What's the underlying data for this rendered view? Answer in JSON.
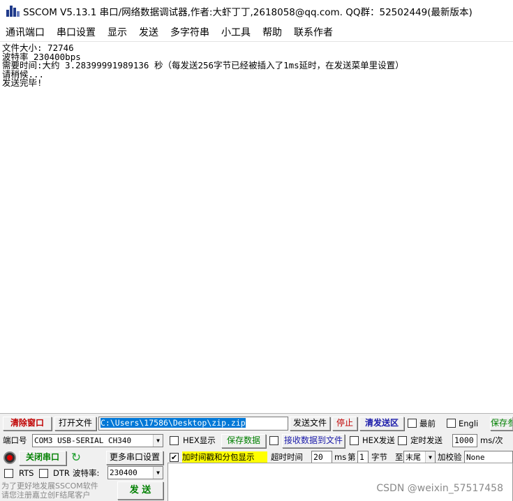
{
  "window": {
    "title": "SSCOM V5.13.1 串口/网络数据调试器,作者:大虾丁丁,2618058@qq.com. QQ群：52502449(最新版本)",
    "logo_icon": "sscom-bars-icon"
  },
  "menu": [
    "通讯端口",
    "串口设置",
    "显示",
    "发送",
    "多字符串",
    "小工具",
    "帮助",
    "联系作者"
  ],
  "output": {
    "lines": [
      "文件大小: 72746",
      "波特率 230400bps",
      "需要时间:大约 3.28399991989136 秒（每发送256字节已经被插入了1ms延时，在发送菜单里设置）",
      "请稍候...",
      "发送完毕!"
    ]
  },
  "toolbar1": {
    "clear_button": "清除窗口",
    "open_file_button": "打开文件",
    "file_path": "C:\\Users\\17586\\Desktop\\zip.zip",
    "send_file_button": "发送文件",
    "stop_button": "停止",
    "clear_send_button": "清发送区",
    "topmost_label": "最前",
    "english_label": "Engli",
    "save_params_label": "保存参"
  },
  "toolbar2": {
    "port_label": "端口号",
    "port_value": "COM3 USB-SERIAL CH340",
    "hex_display_label": "HEX显示",
    "save_data_button": "保存数据",
    "recv_to_file_label": "接收数据到文件",
    "hex_send_label": "HEX发送",
    "timed_send_label": "定时发送",
    "timed_interval": "1000",
    "timed_unit": "ms/次"
  },
  "toolbar3": {
    "close_port_button": "关闭串口",
    "more_settings_button": "更多串口设置",
    "timestamp_label": "加时间戳和分包显示",
    "timeout_label": "超时时间",
    "timeout_value": "20",
    "timeout_unit": "ms",
    "nth_label": "第",
    "nth_value": "1",
    "byte_label": "字节",
    "to_label": "至",
    "end_value": "末尾",
    "checksum_label": "加校验",
    "checksum_value": "None"
  },
  "toolbar4": {
    "rts_label": "RTS",
    "dtr_label": "DTR",
    "baud_label": "波特率:",
    "baud_value": "230400",
    "send_button": "发 送",
    "promo_line1": "为了更好地发展SSCOM软件",
    "promo_line2": "请您注册嘉立创F结尾客户"
  },
  "watermark": "CSDN @weixin_57517458",
  "colors": {
    "highlight": "#ffff00",
    "red_text": "#c00000",
    "green_text": "#008000",
    "selection": "#0078d7"
  }
}
